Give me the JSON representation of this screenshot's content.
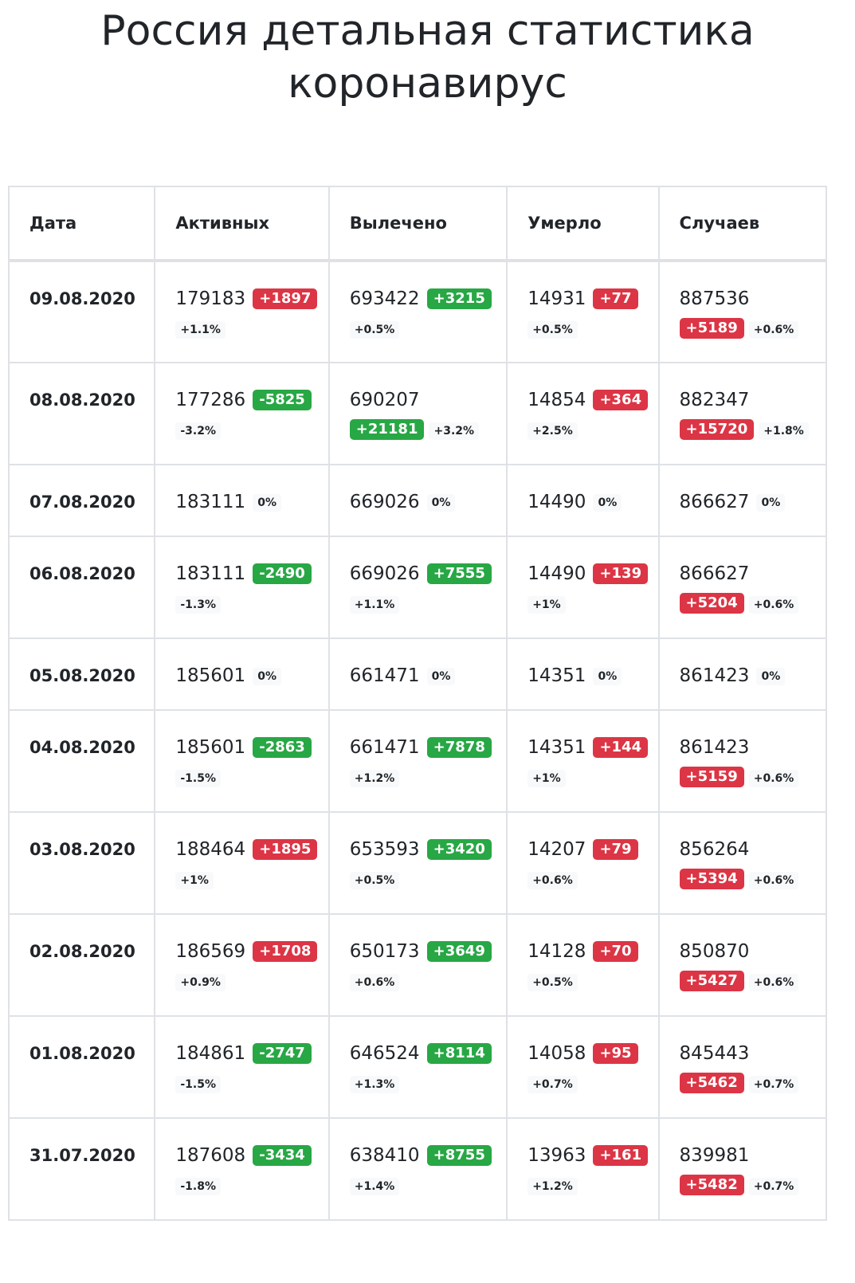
{
  "page": {
    "title_line1": "Россия детальная статистика",
    "title_line2": "коронавирус"
  },
  "table": {
    "headers": {
      "date": "Дата",
      "active": "Активных",
      "recovered": "Вылечено",
      "deaths": "Умерло",
      "cases": "Случаев"
    },
    "rows": [
      {
        "date": "09.08.2020",
        "active": {
          "value": "179183",
          "delta": "+1897",
          "delta_color": "red",
          "pct": "+1.1%"
        },
        "recovered": {
          "value": "693422",
          "delta": "+3215",
          "delta_color": "green",
          "pct": "+0.5%"
        },
        "deaths": {
          "value": "14931",
          "delta": "+77",
          "delta_color": "red",
          "pct": "+0.5%"
        },
        "cases": {
          "value": "887536",
          "delta": "+5189",
          "delta_color": "red",
          "pct": "+0.6%"
        }
      },
      {
        "date": "08.08.2020",
        "active": {
          "value": "177286",
          "delta": "-5825",
          "delta_color": "green",
          "pct": "-3.2%"
        },
        "recovered": {
          "value": "690207",
          "delta": "+21181",
          "delta_color": "green",
          "pct": "+3.2%"
        },
        "deaths": {
          "value": "14854",
          "delta": "+364",
          "delta_color": "red",
          "pct": "+2.5%"
        },
        "cases": {
          "value": "882347",
          "delta": "+15720",
          "delta_color": "red",
          "pct": "+1.8%"
        }
      },
      {
        "date": "07.08.2020",
        "active": {
          "value": "183111",
          "delta": "",
          "pct": "0%"
        },
        "recovered": {
          "value": "669026",
          "delta": "",
          "pct": "0%"
        },
        "deaths": {
          "value": "14490",
          "delta": "",
          "pct": "0%"
        },
        "cases": {
          "value": "866627",
          "delta": "",
          "pct": "0%"
        }
      },
      {
        "date": "06.08.2020",
        "active": {
          "value": "183111",
          "delta": "-2490",
          "delta_color": "green",
          "pct": "-1.3%"
        },
        "recovered": {
          "value": "669026",
          "delta": "+7555",
          "delta_color": "green",
          "pct": "+1.1%"
        },
        "deaths": {
          "value": "14490",
          "delta": "+139",
          "delta_color": "red",
          "pct": "+1%"
        },
        "cases": {
          "value": "866627",
          "delta": "+5204",
          "delta_color": "red",
          "pct": "+0.6%"
        }
      },
      {
        "date": "05.08.2020",
        "active": {
          "value": "185601",
          "delta": "",
          "pct": "0%"
        },
        "recovered": {
          "value": "661471",
          "delta": "",
          "pct": "0%"
        },
        "deaths": {
          "value": "14351",
          "delta": "",
          "pct": "0%"
        },
        "cases": {
          "value": "861423",
          "delta": "",
          "pct": "0%"
        }
      },
      {
        "date": "04.08.2020",
        "active": {
          "value": "185601",
          "delta": "-2863",
          "delta_color": "green",
          "pct": "-1.5%"
        },
        "recovered": {
          "value": "661471",
          "delta": "+7878",
          "delta_color": "green",
          "pct": "+1.2%"
        },
        "deaths": {
          "value": "14351",
          "delta": "+144",
          "delta_color": "red",
          "pct": "+1%"
        },
        "cases": {
          "value": "861423",
          "delta": "+5159",
          "delta_color": "red",
          "pct": "+0.6%"
        }
      },
      {
        "date": "03.08.2020",
        "active": {
          "value": "188464",
          "delta": "+1895",
          "delta_color": "red",
          "pct": "+1%"
        },
        "recovered": {
          "value": "653593",
          "delta": "+3420",
          "delta_color": "green",
          "pct": "+0.5%"
        },
        "deaths": {
          "value": "14207",
          "delta": "+79",
          "delta_color": "red",
          "pct": "+0.6%"
        },
        "cases": {
          "value": "856264",
          "delta": "+5394",
          "delta_color": "red",
          "pct": "+0.6%"
        }
      },
      {
        "date": "02.08.2020",
        "active": {
          "value": "186569",
          "delta": "+1708",
          "delta_color": "red",
          "pct": "+0.9%"
        },
        "recovered": {
          "value": "650173",
          "delta": "+3649",
          "delta_color": "green",
          "pct": "+0.6%"
        },
        "deaths": {
          "value": "14128",
          "delta": "+70",
          "delta_color": "red",
          "pct": "+0.5%"
        },
        "cases": {
          "value": "850870",
          "delta": "+5427",
          "delta_color": "red",
          "pct": "+0.6%"
        }
      },
      {
        "date": "01.08.2020",
        "active": {
          "value": "184861",
          "delta": "-2747",
          "delta_color": "green",
          "pct": "-1.5%"
        },
        "recovered": {
          "value": "646524",
          "delta": "+8114",
          "delta_color": "green",
          "pct": "+1.3%"
        },
        "deaths": {
          "value": "14058",
          "delta": "+95",
          "delta_color": "red",
          "pct": "+0.7%"
        },
        "cases": {
          "value": "845443",
          "delta": "+5462",
          "delta_color": "red",
          "pct": "+0.7%"
        }
      },
      {
        "date": "31.07.2020",
        "active": {
          "value": "187608",
          "delta": "-3434",
          "delta_color": "green",
          "pct": "-1.8%"
        },
        "recovered": {
          "value": "638410",
          "delta": "+8755",
          "delta_color": "green",
          "pct": "+1.4%"
        },
        "deaths": {
          "value": "13963",
          "delta": "+161",
          "delta_color": "red",
          "pct": "+1.2%"
        },
        "cases": {
          "value": "839981",
          "delta": "+5482",
          "delta_color": "red",
          "pct": "+0.7%"
        }
      }
    ]
  },
  "colors": {
    "increase_bad": "#dc3545",
    "increase_good": "#28a745",
    "border": "#dee2e6"
  }
}
